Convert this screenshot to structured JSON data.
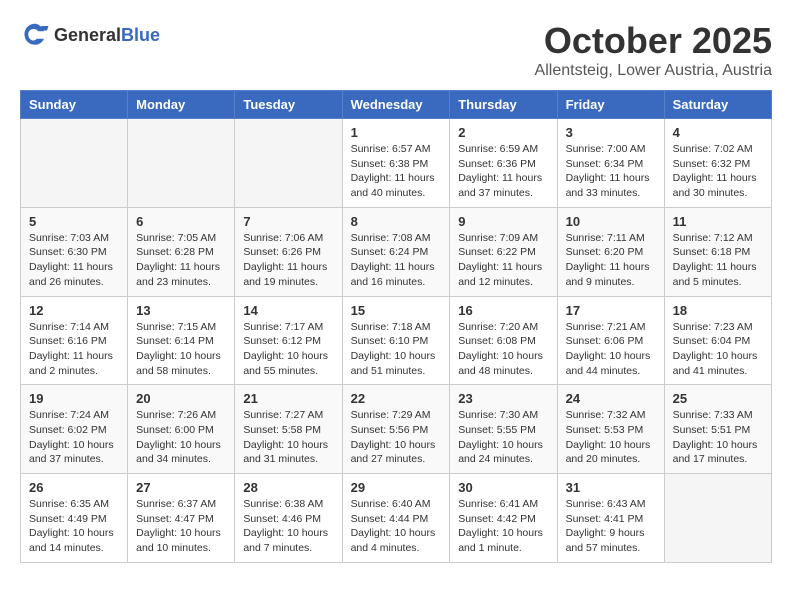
{
  "header": {
    "logo_general": "General",
    "logo_blue": "Blue",
    "month": "October 2025",
    "location": "Allentsteig, Lower Austria, Austria"
  },
  "weekdays": [
    "Sunday",
    "Monday",
    "Tuesday",
    "Wednesday",
    "Thursday",
    "Friday",
    "Saturday"
  ],
  "weeks": [
    [
      {
        "day": "",
        "info": ""
      },
      {
        "day": "",
        "info": ""
      },
      {
        "day": "",
        "info": ""
      },
      {
        "day": "1",
        "info": "Sunrise: 6:57 AM\nSunset: 6:38 PM\nDaylight: 11 hours\nand 40 minutes."
      },
      {
        "day": "2",
        "info": "Sunrise: 6:59 AM\nSunset: 6:36 PM\nDaylight: 11 hours\nand 37 minutes."
      },
      {
        "day": "3",
        "info": "Sunrise: 7:00 AM\nSunset: 6:34 PM\nDaylight: 11 hours\nand 33 minutes."
      },
      {
        "day": "4",
        "info": "Sunrise: 7:02 AM\nSunset: 6:32 PM\nDaylight: 11 hours\nand 30 minutes."
      }
    ],
    [
      {
        "day": "5",
        "info": "Sunrise: 7:03 AM\nSunset: 6:30 PM\nDaylight: 11 hours\nand 26 minutes."
      },
      {
        "day": "6",
        "info": "Sunrise: 7:05 AM\nSunset: 6:28 PM\nDaylight: 11 hours\nand 23 minutes."
      },
      {
        "day": "7",
        "info": "Sunrise: 7:06 AM\nSunset: 6:26 PM\nDaylight: 11 hours\nand 19 minutes."
      },
      {
        "day": "8",
        "info": "Sunrise: 7:08 AM\nSunset: 6:24 PM\nDaylight: 11 hours\nand 16 minutes."
      },
      {
        "day": "9",
        "info": "Sunrise: 7:09 AM\nSunset: 6:22 PM\nDaylight: 11 hours\nand 12 minutes."
      },
      {
        "day": "10",
        "info": "Sunrise: 7:11 AM\nSunset: 6:20 PM\nDaylight: 11 hours\nand 9 minutes."
      },
      {
        "day": "11",
        "info": "Sunrise: 7:12 AM\nSunset: 6:18 PM\nDaylight: 11 hours\nand 5 minutes."
      }
    ],
    [
      {
        "day": "12",
        "info": "Sunrise: 7:14 AM\nSunset: 6:16 PM\nDaylight: 11 hours\nand 2 minutes."
      },
      {
        "day": "13",
        "info": "Sunrise: 7:15 AM\nSunset: 6:14 PM\nDaylight: 10 hours\nand 58 minutes."
      },
      {
        "day": "14",
        "info": "Sunrise: 7:17 AM\nSunset: 6:12 PM\nDaylight: 10 hours\nand 55 minutes."
      },
      {
        "day": "15",
        "info": "Sunrise: 7:18 AM\nSunset: 6:10 PM\nDaylight: 10 hours\nand 51 minutes."
      },
      {
        "day": "16",
        "info": "Sunrise: 7:20 AM\nSunset: 6:08 PM\nDaylight: 10 hours\nand 48 minutes."
      },
      {
        "day": "17",
        "info": "Sunrise: 7:21 AM\nSunset: 6:06 PM\nDaylight: 10 hours\nand 44 minutes."
      },
      {
        "day": "18",
        "info": "Sunrise: 7:23 AM\nSunset: 6:04 PM\nDaylight: 10 hours\nand 41 minutes."
      }
    ],
    [
      {
        "day": "19",
        "info": "Sunrise: 7:24 AM\nSunset: 6:02 PM\nDaylight: 10 hours\nand 37 minutes."
      },
      {
        "day": "20",
        "info": "Sunrise: 7:26 AM\nSunset: 6:00 PM\nDaylight: 10 hours\nand 34 minutes."
      },
      {
        "day": "21",
        "info": "Sunrise: 7:27 AM\nSunset: 5:58 PM\nDaylight: 10 hours\nand 31 minutes."
      },
      {
        "day": "22",
        "info": "Sunrise: 7:29 AM\nSunset: 5:56 PM\nDaylight: 10 hours\nand 27 minutes."
      },
      {
        "day": "23",
        "info": "Sunrise: 7:30 AM\nSunset: 5:55 PM\nDaylight: 10 hours\nand 24 minutes."
      },
      {
        "day": "24",
        "info": "Sunrise: 7:32 AM\nSunset: 5:53 PM\nDaylight: 10 hours\nand 20 minutes."
      },
      {
        "day": "25",
        "info": "Sunrise: 7:33 AM\nSunset: 5:51 PM\nDaylight: 10 hours\nand 17 minutes."
      }
    ],
    [
      {
        "day": "26",
        "info": "Sunrise: 6:35 AM\nSunset: 4:49 PM\nDaylight: 10 hours\nand 14 minutes."
      },
      {
        "day": "27",
        "info": "Sunrise: 6:37 AM\nSunset: 4:47 PM\nDaylight: 10 hours\nand 10 minutes."
      },
      {
        "day": "28",
        "info": "Sunrise: 6:38 AM\nSunset: 4:46 PM\nDaylight: 10 hours\nand 7 minutes."
      },
      {
        "day": "29",
        "info": "Sunrise: 6:40 AM\nSunset: 4:44 PM\nDaylight: 10 hours\nand 4 minutes."
      },
      {
        "day": "30",
        "info": "Sunrise: 6:41 AM\nSunset: 4:42 PM\nDaylight: 10 hours\nand 1 minute."
      },
      {
        "day": "31",
        "info": "Sunrise: 6:43 AM\nSunset: 4:41 PM\nDaylight: 9 hours\nand 57 minutes."
      },
      {
        "day": "",
        "info": ""
      }
    ]
  ]
}
